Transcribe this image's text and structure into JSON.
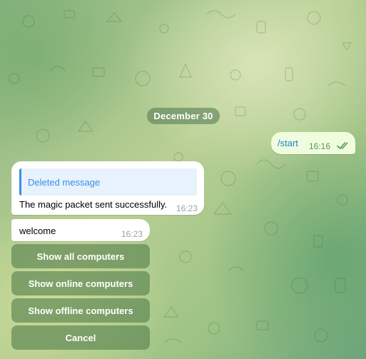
{
  "date_separator": "December 30",
  "outgoing": {
    "text": "/start",
    "time": "16:16",
    "status_icon": "double-check-icon"
  },
  "incoming": [
    {
      "reply_to": "Deleted message",
      "text": "The magic packet sent successfully.",
      "time": "16:23"
    },
    {
      "text": "welcome",
      "time": "16:23"
    }
  ],
  "keyboard": {
    "buttons": [
      "Show all computers",
      "Show online computers",
      "Show offline computers",
      "Cancel"
    ]
  },
  "colors": {
    "outgoing_bubble": "#effdde",
    "incoming_bubble": "#ffffff",
    "link_blue": "#2481cc",
    "check_green": "#5a9a56",
    "keyboard_button": "#56804e"
  }
}
